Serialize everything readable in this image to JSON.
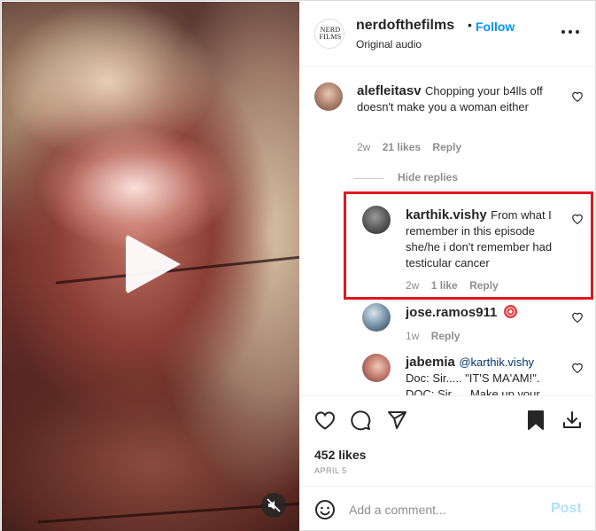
{
  "header": {
    "avatar_text_line1": "NERD",
    "avatar_text_line2": "FILMS",
    "username": "nerdofthefilms",
    "separator": "•",
    "follow_label": "Follow",
    "subtitle": "Original audio"
  },
  "comments": [
    {
      "username": "alefleitasv",
      "text": "Chopping your b4lls off doesn't make you a woman either",
      "time": "2w",
      "likes": "21 likes",
      "reply_label": "Reply"
    }
  ],
  "replies_toggle": "Hide replies",
  "replies": [
    {
      "username": "karthik.vishy",
      "text": "From what I remember in this episode she/he i don't remember had testicular cancer",
      "time": "2w",
      "likes": "1 like",
      "reply_label": "Reply",
      "highlighted": true
    },
    {
      "username": "jose.ramos911",
      "text": "",
      "time": "1w",
      "likes": "",
      "reply_label": "Reply"
    },
    {
      "username": "jabemia",
      "mention": "@karthik.vishy",
      "text": "Doc: Sir..... \"IT'S MA'AM!\".",
      "text_cut": "DOC: Sir..... Make up your mind"
    }
  ],
  "post": {
    "likes": "452 likes",
    "date": "APRIL 5"
  },
  "add_comment": {
    "placeholder": "Add a comment...",
    "post_label": "Post"
  },
  "colors": {
    "accent": "#0095f6",
    "highlight_box": "#e0171f",
    "muted": "#8e8e8e",
    "post_disabled": "#b2dffc"
  },
  "icons": {
    "play": "play-icon",
    "mute": "speaker-muted-icon",
    "more": "more-horizontal-icon",
    "heart": "heart-icon",
    "comment": "comment-icon",
    "share": "paper-plane-icon",
    "save": "bookmark-filled-icon",
    "download": "download-icon",
    "emoji": "emoji-icon"
  }
}
